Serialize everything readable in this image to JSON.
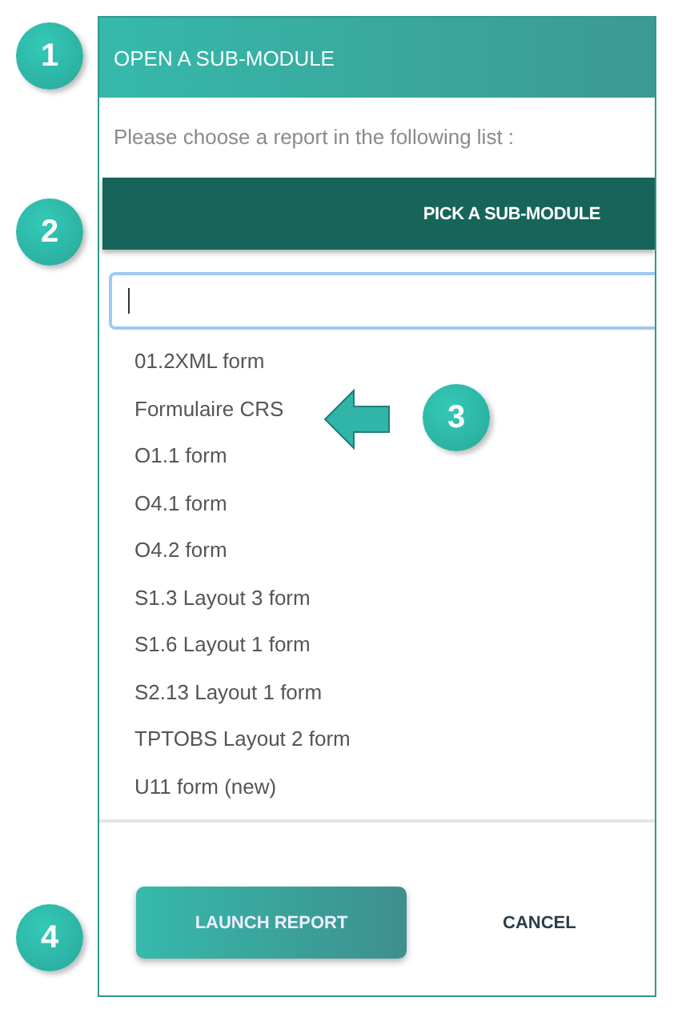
{
  "dialog": {
    "title": "OPEN A SUB-MODULE",
    "prompt": "Please choose a report in the following list :"
  },
  "picker": {
    "label": "PICK A SUB-MODULE"
  },
  "search": {
    "focused": true
  },
  "items": [
    "01.2XML form",
    "Formulaire CRS",
    "O1.1 form",
    "O4.1 form",
    "O4.2 form",
    "S1.3 Layout 3 form",
    "S1.6 Layout 1 form",
    "S2.13 Layout 1 form",
    "TPTOBS Layout 2 form",
    "U11 form (new)"
  ],
  "buttons": [
    {
      "label": "LAUNCH REPORT",
      "kind": "primary"
    },
    {
      "label": "CANCEL",
      "kind": "flat"
    }
  ],
  "callouts": [
    "1",
    "2",
    "3",
    "4"
  ]
}
